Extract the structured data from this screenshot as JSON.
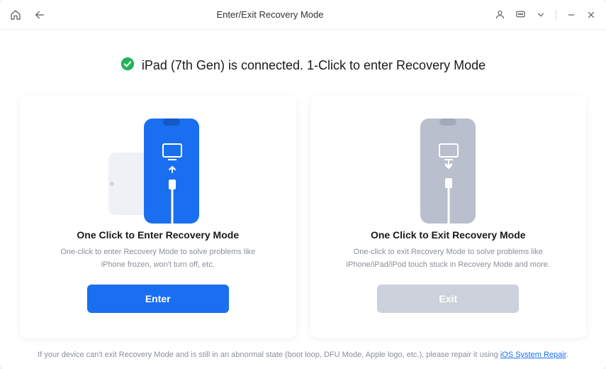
{
  "header": {
    "title": "Enter/Exit Recovery Mode"
  },
  "status": {
    "text": "iPad (7th Gen) is connected. 1-Click to enter Recovery Mode"
  },
  "cards": {
    "enter": {
      "title": "One Click to Enter Recovery Mode",
      "desc": "One-click to enter Recovery Mode to solve problems like iPhone frozen, won't turn off, etc.",
      "button": "Enter"
    },
    "exit": {
      "title": "One Click to Exit Recovery Mode",
      "desc": "One-click to exit Recovery Mode to solve problems like iPhone/iPad/iPod touch stuck in Recovery Mode and more.",
      "button": "Exit"
    }
  },
  "footer": {
    "text_prefix": "If your device can't exit Recovery Mode and is still in an abnormal state (boot loop, DFU Mode, Apple logo, etc.), please repair it using ",
    "link_text": "iOS System Repair",
    "text_suffix": "."
  },
  "colors": {
    "accent": "#1a6ff1",
    "success": "#24b35a",
    "muted": "#b9bfcd"
  }
}
